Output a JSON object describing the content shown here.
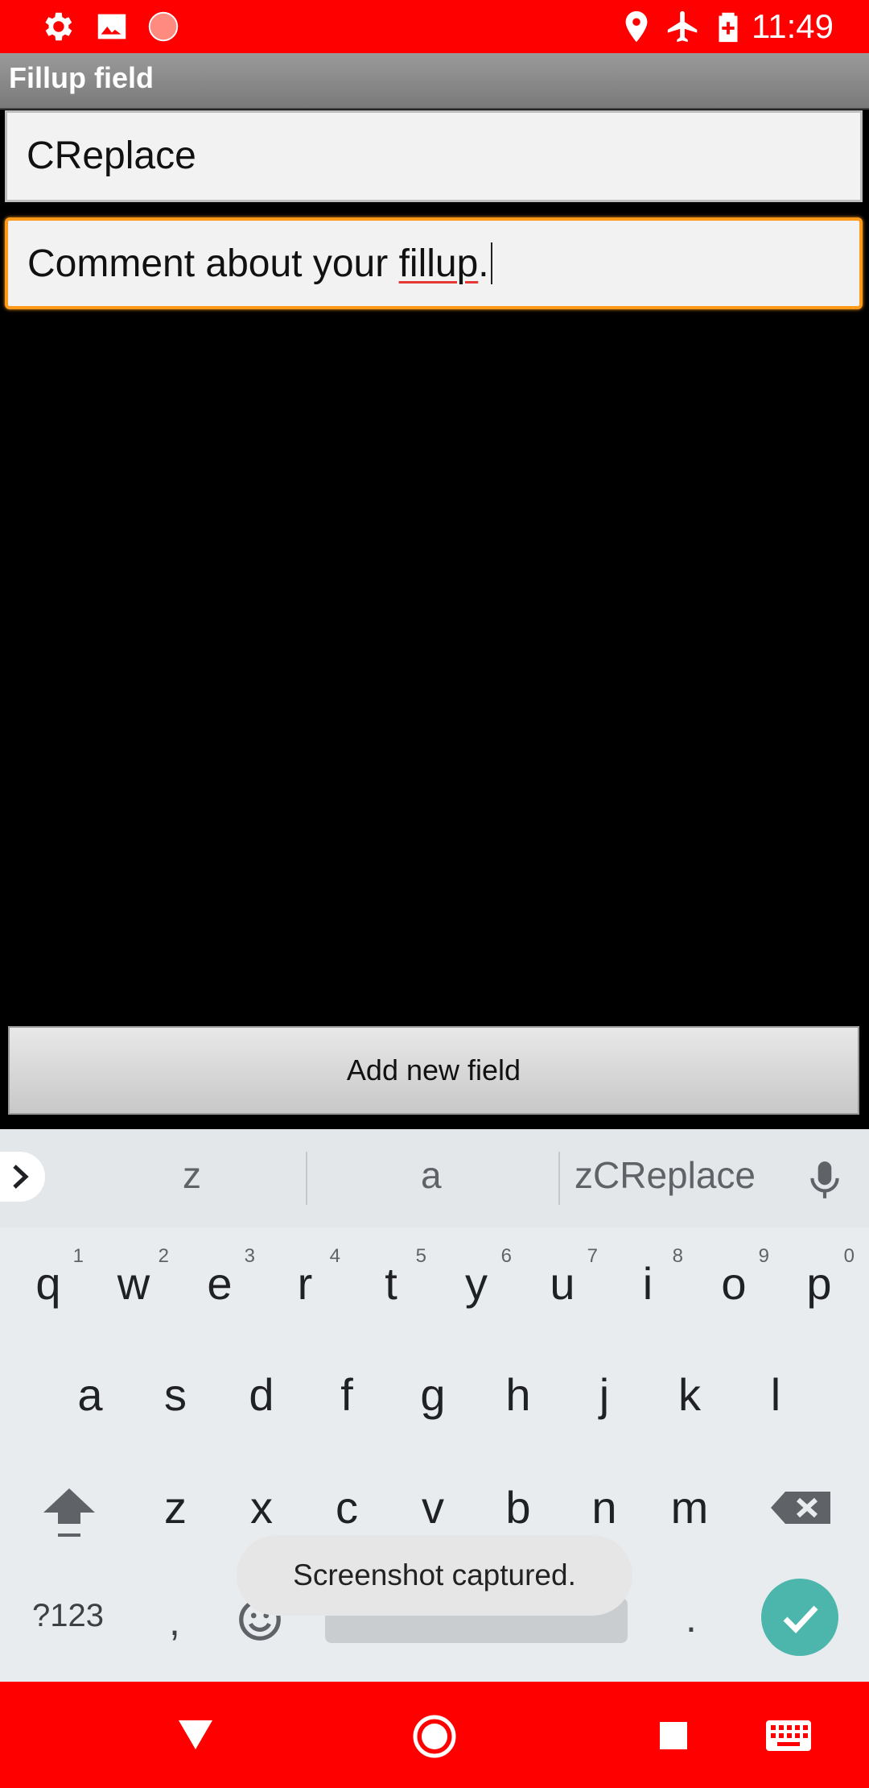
{
  "status_bar": {
    "time": "11:49",
    "left_icons": [
      "settings-icon",
      "image-icon",
      "record-icon"
    ],
    "right_icons": [
      "location-icon",
      "airplane-icon",
      "battery-charging-icon"
    ],
    "background": "#ff0000"
  },
  "title_bar": {
    "title": "Fillup field"
  },
  "form": {
    "field1_value": "CReplace",
    "field2_value_prefix": "Comment about your ",
    "field2_value_misspelled": "fillup",
    "field2_value_suffix": ".",
    "focus_color": "#ff9a1a"
  },
  "add_button": {
    "label": "Add new field"
  },
  "keyboard": {
    "suggestions": [
      "z",
      "a",
      "zCReplace"
    ],
    "row1": [
      {
        "key": "q",
        "hint": "1"
      },
      {
        "key": "w",
        "hint": "2"
      },
      {
        "key": "e",
        "hint": "3"
      },
      {
        "key": "r",
        "hint": "4"
      },
      {
        "key": "t",
        "hint": "5"
      },
      {
        "key": "y",
        "hint": "6"
      },
      {
        "key": "u",
        "hint": "7"
      },
      {
        "key": "i",
        "hint": "8"
      },
      {
        "key": "o",
        "hint": "9"
      },
      {
        "key": "p",
        "hint": "0"
      }
    ],
    "row2": [
      "a",
      "s",
      "d",
      "f",
      "g",
      "h",
      "j",
      "k",
      "l"
    ],
    "row3": [
      "z",
      "x",
      "c",
      "v",
      "b",
      "n",
      "m"
    ],
    "symbols_label": "?123",
    "comma": ",",
    "period": ".",
    "enter_color": "#4db6ac"
  },
  "toast": {
    "message": "Screenshot captured."
  },
  "nav_bar": {
    "icons": [
      "back-icon",
      "home-icon",
      "recents-icon",
      "keyboard-icon"
    ],
    "background": "#ff0000"
  }
}
